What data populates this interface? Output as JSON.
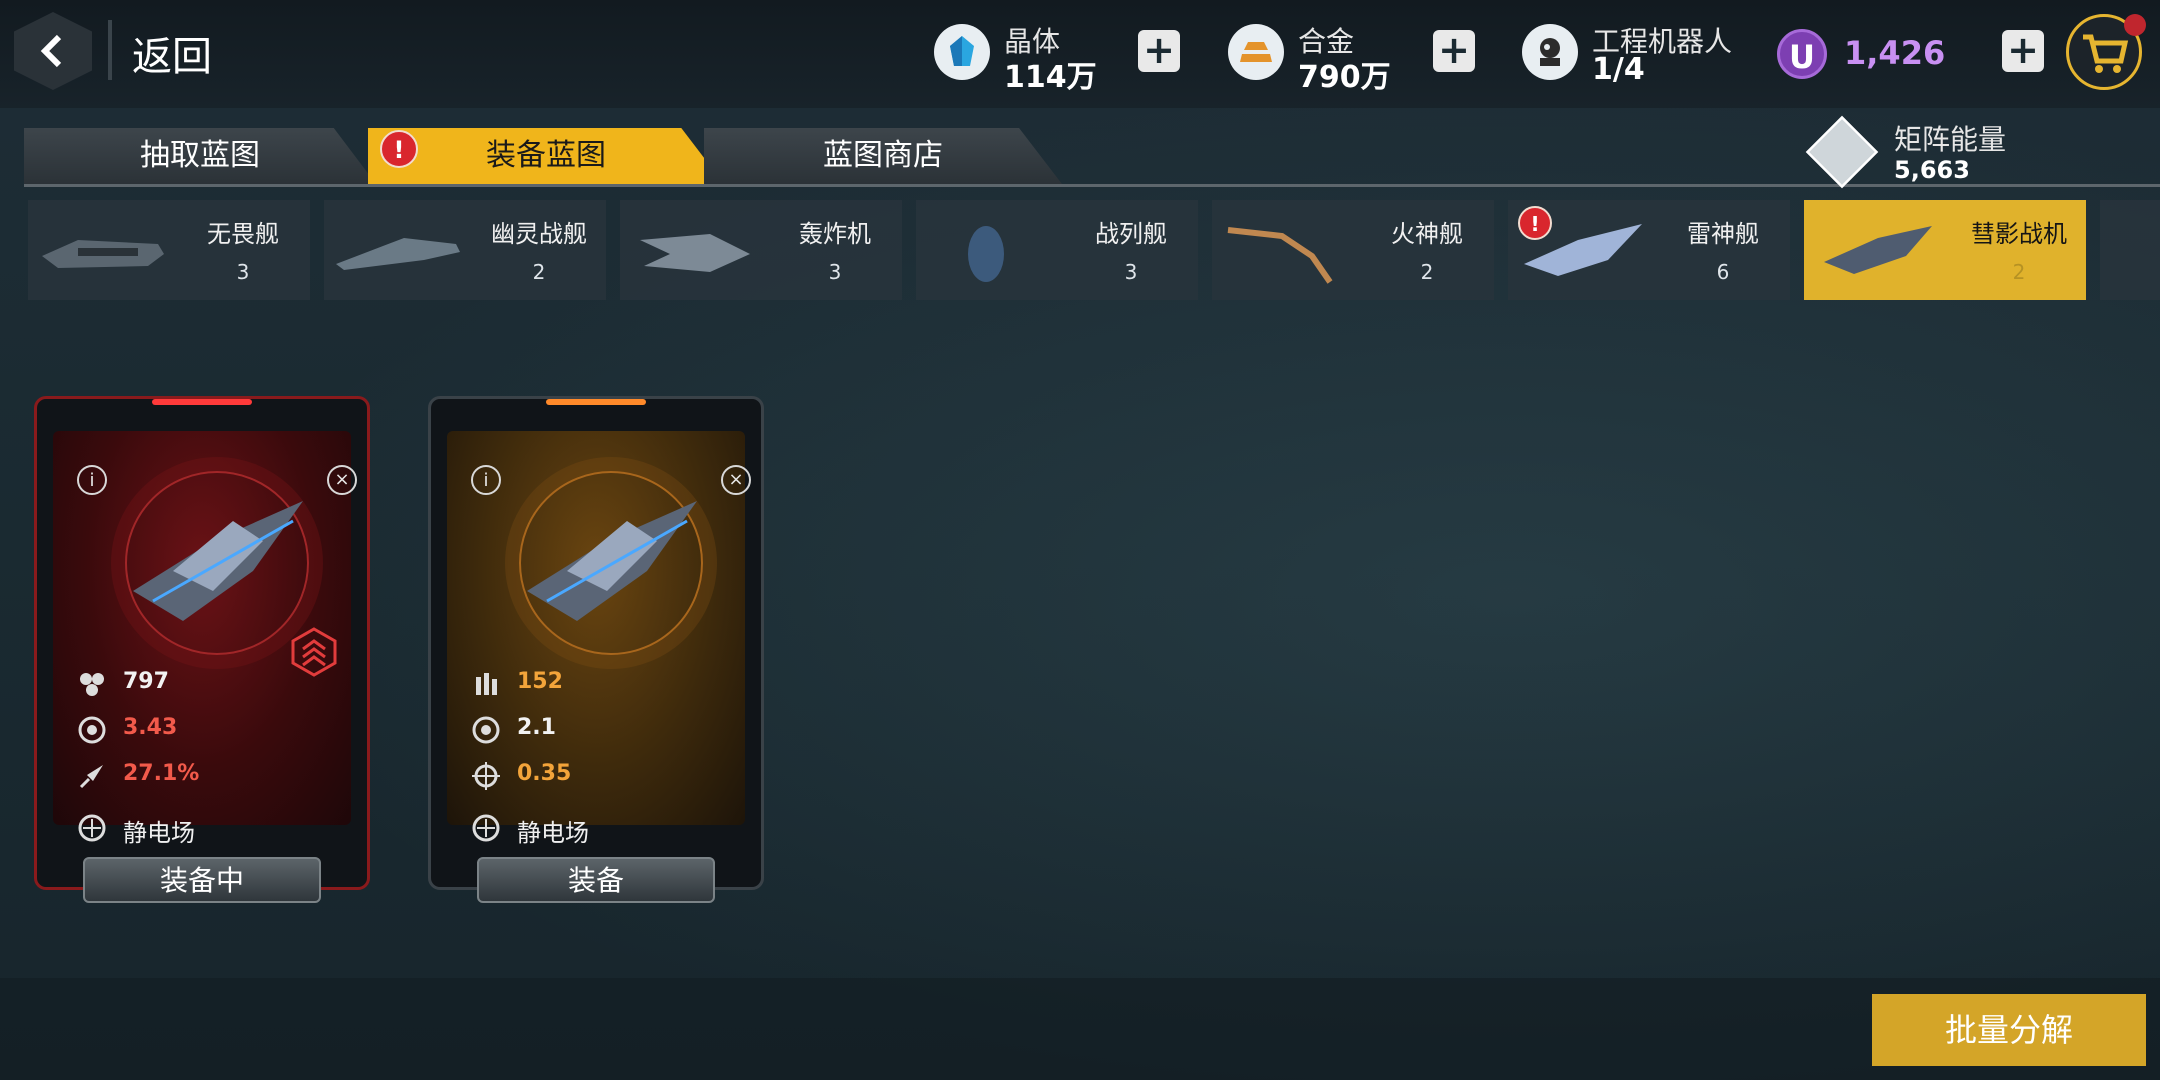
{
  "header": {
    "back_label": "返回",
    "resources": [
      {
        "name": "晶体",
        "value": "114万",
        "icon": "crystal-icon",
        "color": "#2aa6e0"
      },
      {
        "name": "合金",
        "value": "790万",
        "icon": "alloy-icon",
        "color": "#e4932b"
      },
      {
        "name": "工程机器人",
        "value": "1/4",
        "icon": "robot-icon"
      }
    ],
    "premium": {
      "symbol": "U",
      "value": "1,426",
      "color": "#c890f2"
    }
  },
  "tabs": [
    {
      "label": "抽取蓝图",
      "active": false
    },
    {
      "label": "装备蓝图",
      "active": true,
      "alert": "!"
    },
    {
      "label": "蓝图商店",
      "active": false
    }
  ],
  "matrix_energy": {
    "label": "矩阵能量",
    "value": "5,663"
  },
  "categories": [
    {
      "name": "无畏舰",
      "count": "3"
    },
    {
      "name": "幽灵战舰",
      "count": "2"
    },
    {
      "name": "轰炸机",
      "count": "3"
    },
    {
      "name": "战列舰",
      "count": "3"
    },
    {
      "name": "火神舰",
      "count": "2"
    },
    {
      "name": "雷神舰",
      "count": "6",
      "alert": "!"
    },
    {
      "name": "彗影战机",
      "count": "2",
      "selected": true
    }
  ],
  "cards": [
    {
      "theme": "red",
      "stats": [
        {
          "icon": "hexagon-cluster-icon",
          "value": "797",
          "color": "white"
        },
        {
          "icon": "gear-icon",
          "value": "3.43",
          "color": "red"
        },
        {
          "icon": "rocket-icon",
          "value": "27.1%",
          "color": "red"
        }
      ],
      "skill": "静电场",
      "button": "装备中"
    },
    {
      "theme": "orange",
      "stats": [
        {
          "icon": "bullets-icon",
          "value": "152",
          "color": "orange"
        },
        {
          "icon": "gear-icon",
          "value": "2.1",
          "color": "white"
        },
        {
          "icon": "crosshair-icon",
          "value": "0.35",
          "color": "orange"
        }
      ],
      "skill": "静电场",
      "button": "装备"
    }
  ],
  "batch_button": "批量分解"
}
